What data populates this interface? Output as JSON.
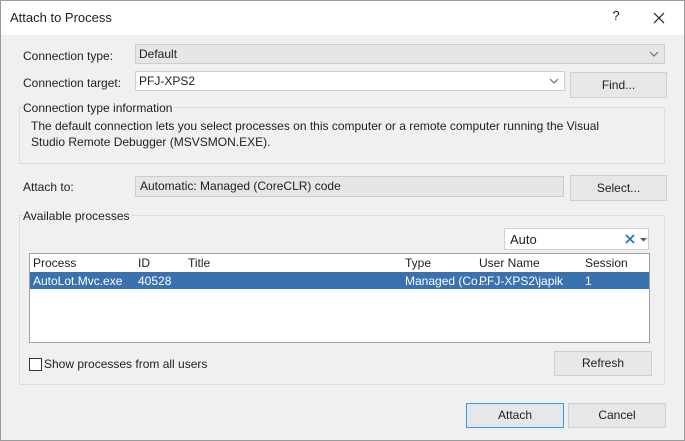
{
  "window": {
    "title": "Attach to Process",
    "help_glyph": "?",
    "close_icon": "close-icon"
  },
  "connection": {
    "type_label": "Connection type:",
    "type_value": "Default",
    "target_label": "Connection target:",
    "target_value": "PFJ-XPS2",
    "find_button": "Find..."
  },
  "info": {
    "heading": "Connection type information",
    "text": "The default connection lets you select processes on this computer or a remote computer running the Visual Studio Remote Debugger (MSVSMON.EXE)."
  },
  "attach_to": {
    "label": "Attach to:",
    "value": "Automatic: Managed (CoreCLR) code",
    "select_button": "Select..."
  },
  "processes": {
    "heading": "Available processes",
    "filter_value": "Auto",
    "columns": [
      "Process",
      "ID",
      "Title",
      "Type",
      "User Name",
      "Session"
    ],
    "rows": [
      {
        "process": "AutoLot.Mvc.exe",
        "id": "40528",
        "title": "",
        "type": "Managed (Co...",
        "user": "PFJ-XPS2\\japik",
        "session": "1",
        "selected": true
      }
    ],
    "show_all_label": "Show processes from all users",
    "show_all_checked": false,
    "refresh_button": "Refresh"
  },
  "footer": {
    "attach_button": "Attach",
    "cancel_button": "Cancel"
  },
  "colors": {
    "selection": "#3a72b0",
    "dialog_bg": "#f0f0f0",
    "default_button_border": "#3399ff"
  }
}
